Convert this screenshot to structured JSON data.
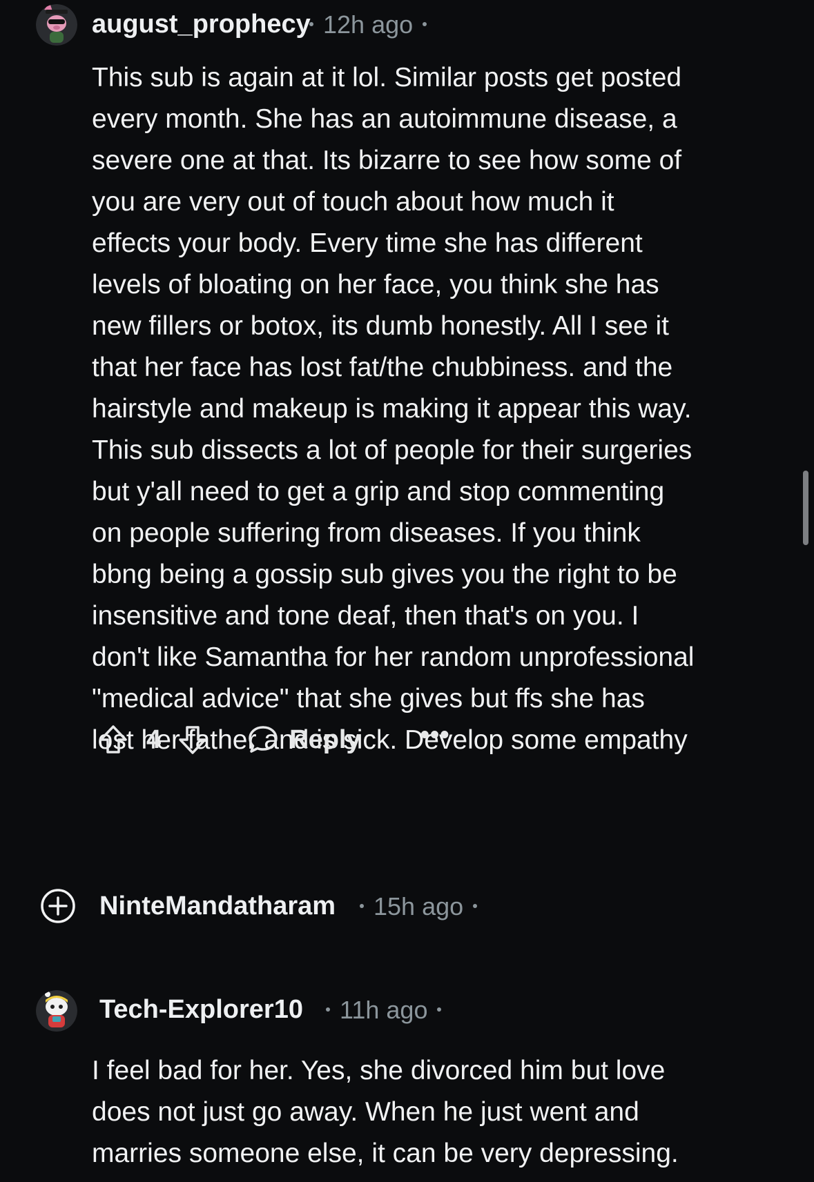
{
  "comments": [
    {
      "username": "august_prophecy",
      "time": "12h ago",
      "body": "This sub is again at it lol. Similar posts get posted\nevery month. She has an autoimmune disease, a\nsevere one at that. Its bizarre to see how some of\nyou are very out of touch about how much it\neffects your body. Every time she has different\nlevels of bloating on her face, you think she has\nnew fillers or botox, its dumb honestly. All I see it\nthat her face has lost fat/the chubbiness. and the\nhairstyle and makeup is making it appear this way.\nThis sub dissects a lot of people for their surgeries\nbut y'all need to get a grip and stop commenting\non people suffering from diseases. If you think\nbbng being a gossip sub gives you the right to be\ninsensitive and tone deaf, then that's on you. I\ndon't like Samantha for her random unprofessional\n\"medical advice\" that she gives but ffs she has\nlost her father and is sick. Develop some empathy",
      "votes": "4",
      "reply_label": "Reply",
      "more_label": "•••"
    },
    {
      "username": "NinteMandatharam",
      "time": "15h ago",
      "collapsed": true
    },
    {
      "username": "Tech-Explorer10",
      "time": "11h ago",
      "body": "I feel bad for her. Yes, she divorced him but love\ndoes not just go away. When he just went and\nmarries someone else, it can be very depressing."
    }
  ],
  "colors": {
    "background": "#0b0c0e",
    "text": "#f1f2f3",
    "meta": "#8c969c",
    "accent_pink": "#e07fa8"
  }
}
